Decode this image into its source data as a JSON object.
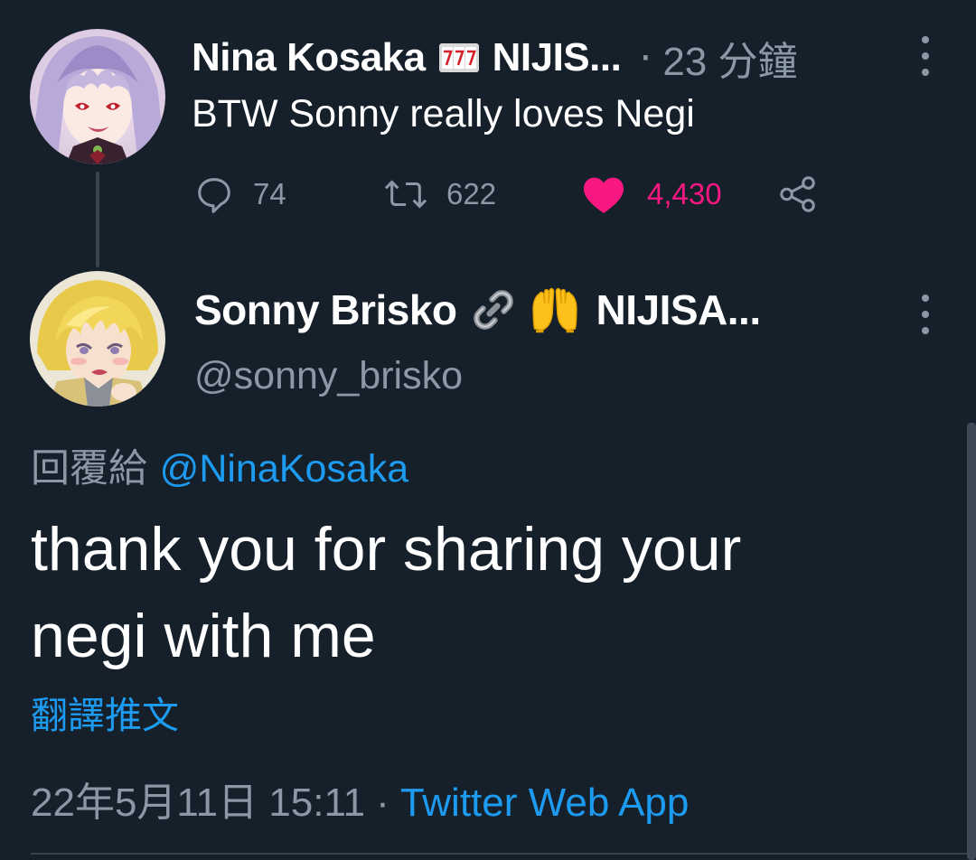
{
  "parent_tweet": {
    "author_name": "Nina Kosaka",
    "author_suffix": "NIJIS...",
    "badge_icon": "slot-machine-777-icon",
    "time_ago": "23 分鐘",
    "separator": "·",
    "text": "BTW Sonny really loves Negi",
    "replies": "74",
    "retweets": "622",
    "likes": "4,430",
    "liked": true,
    "like_color": "#f91880"
  },
  "focal_tweet": {
    "author_name": "Sonny Brisko",
    "author_emoji_icons": [
      "link-icon",
      "raised-hands-icon"
    ],
    "author_suffix": "NIJISA...",
    "handle": "@sonny_brisko",
    "reply_prefix": "回覆給",
    "reply_to": "@NinaKosaka",
    "text_line1": "thank you for sharing your",
    "text_line2": "negi with me",
    "translate_label": "翻譯推文",
    "date": "22年5月11日 15:11",
    "separator": "·",
    "client": "Twitter Web App"
  },
  "theme": {
    "background": "#15202b",
    "text_primary": "#ffffff",
    "text_secondary": "#8b98a5",
    "link": "#1d9bf0",
    "divider": "#38444d"
  }
}
